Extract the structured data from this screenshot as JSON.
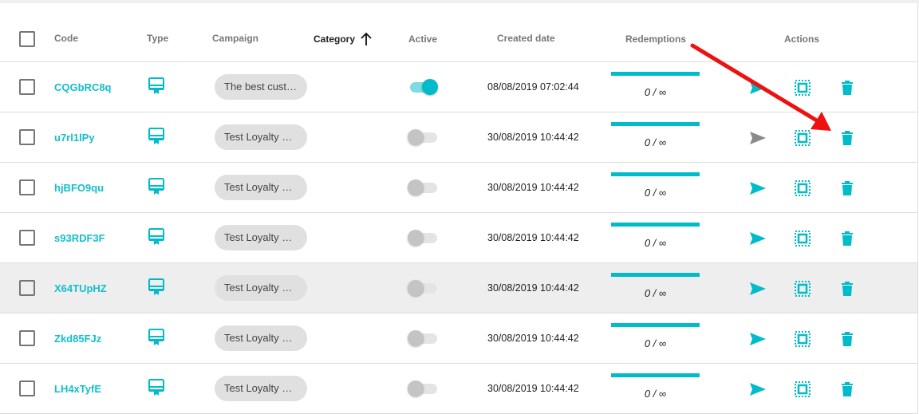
{
  "header": {
    "code": "Code",
    "type": "Type",
    "campaign": "Campaign",
    "category": "Category",
    "active": "Active",
    "created_date": "Created date",
    "redemptions": "Redemptions",
    "actions": "Actions"
  },
  "sort": {
    "column": "Category",
    "direction": "ascending",
    "icon": "arrow-up-icon"
  },
  "colors": {
    "accent": "#00bcca",
    "annotation": "#ee1111",
    "highlight_row": "#eeeeee"
  },
  "rows": [
    {
      "code": "CQGbRC8q",
      "campaign": "The best cust…",
      "active": true,
      "created": "08/08/2019 07:02:44",
      "redemptions": "0 / ∞",
      "send_enabled": true
    },
    {
      "code": "u7rl1lPy",
      "campaign": "Test Loyalty …",
      "active": false,
      "created": "30/08/2019 10:44:42",
      "redemptions": "0 / ∞",
      "send_enabled": false
    },
    {
      "code": "hjBFO9qu",
      "campaign": "Test Loyalty …",
      "active": false,
      "created": "30/08/2019 10:44:42",
      "redemptions": "0 / ∞",
      "send_enabled": true
    },
    {
      "code": "s93RDF3F",
      "campaign": "Test Loyalty …",
      "active": false,
      "created": "30/08/2019 10:44:42",
      "redemptions": "0 / ∞",
      "send_enabled": true
    },
    {
      "code": "X64TUpHZ",
      "campaign": "Test Loyalty …",
      "active": false,
      "created": "30/08/2019 10:44:42",
      "redemptions": "0 / ∞",
      "send_enabled": true,
      "hovered": true
    },
    {
      "code": "Zkd85FJz",
      "campaign": "Test Loyalty …",
      "active": false,
      "created": "30/08/2019 10:44:42",
      "redemptions": "0 / ∞",
      "send_enabled": true
    },
    {
      "code": "LH4xTyfE",
      "campaign": "Test Loyalty …",
      "active": false,
      "created": "30/08/2019 10:44:42",
      "redemptions": "0 / ∞",
      "send_enabled": true
    }
  ]
}
